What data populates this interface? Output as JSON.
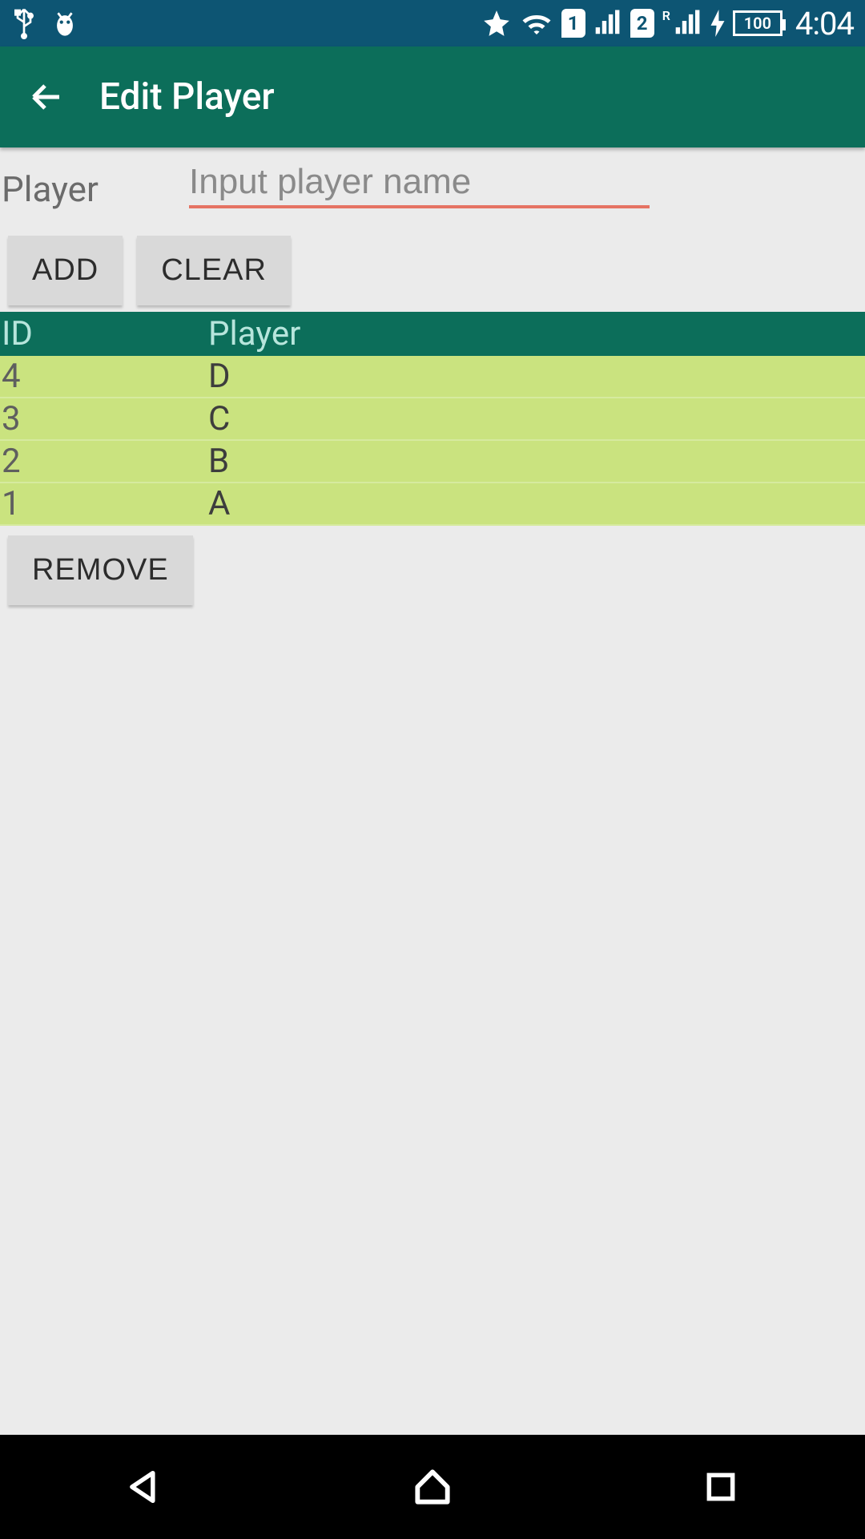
{
  "status": {
    "clock": "4:04",
    "battery": "100",
    "roaming_label": "R",
    "sim1": "1",
    "sim2": "2"
  },
  "appbar": {
    "title": "Edit Player"
  },
  "form": {
    "label": "Player",
    "placeholder": "Input player name",
    "value": ""
  },
  "buttons": {
    "add": "ADD",
    "clear": "CLEAR",
    "remove": "REMOVE"
  },
  "table": {
    "headers": {
      "id": "ID",
      "player": "Player"
    },
    "rows": [
      {
        "id": "4",
        "player": "D"
      },
      {
        "id": "3",
        "player": "C"
      },
      {
        "id": "2",
        "player": "B"
      },
      {
        "id": "1",
        "player": "A"
      }
    ]
  }
}
